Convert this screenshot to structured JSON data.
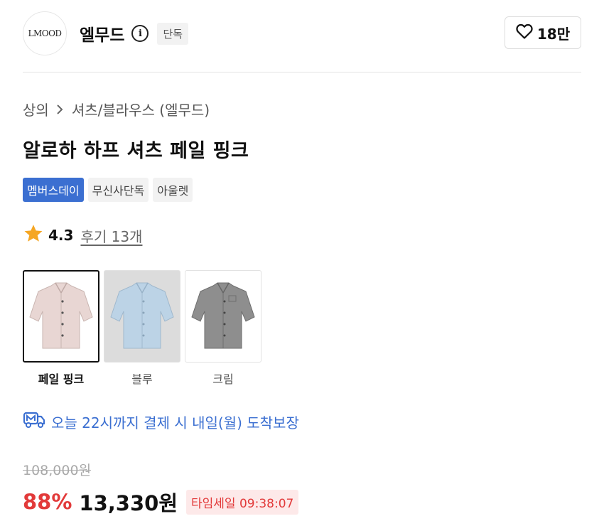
{
  "brand": {
    "logo_text": "LMOOD",
    "name": "엘무드",
    "exclusive_badge": "단독",
    "likes": "18만"
  },
  "breadcrumb": {
    "category": "상의",
    "subcategory": "셔츠/블라우스 (엘무드)"
  },
  "product": {
    "title": "알로하 하프 셔츠 페일 핑크",
    "tags": [
      "멤버스데이",
      "무신사단독",
      "아울렛"
    ],
    "rating": "4.3",
    "reviews": "후기 13개"
  },
  "colors": [
    {
      "label": "페일 핑크",
      "selected": true,
      "shirt_color": "#e8d6d3",
      "bg_color": "#ffffff"
    },
    {
      "label": "블루",
      "selected": false,
      "shirt_color": "#bcd3e6",
      "bg_color": "#dcdcdc"
    },
    {
      "label": "크림",
      "selected": false,
      "shirt_color": "#8e8e8e",
      "bg_color": "#ffffff"
    }
  ],
  "delivery": {
    "text": "오늘 22시까지 결제 시 내일(월) 도착보장"
  },
  "price": {
    "original": "108,000원",
    "discount": "88%",
    "sale": "13,330원",
    "timesale": "타임세일 09:38:07"
  },
  "theme": {
    "accent_blue": "#3b6fd1",
    "sale_red": "#e23a3a",
    "star": "#f5a623"
  }
}
